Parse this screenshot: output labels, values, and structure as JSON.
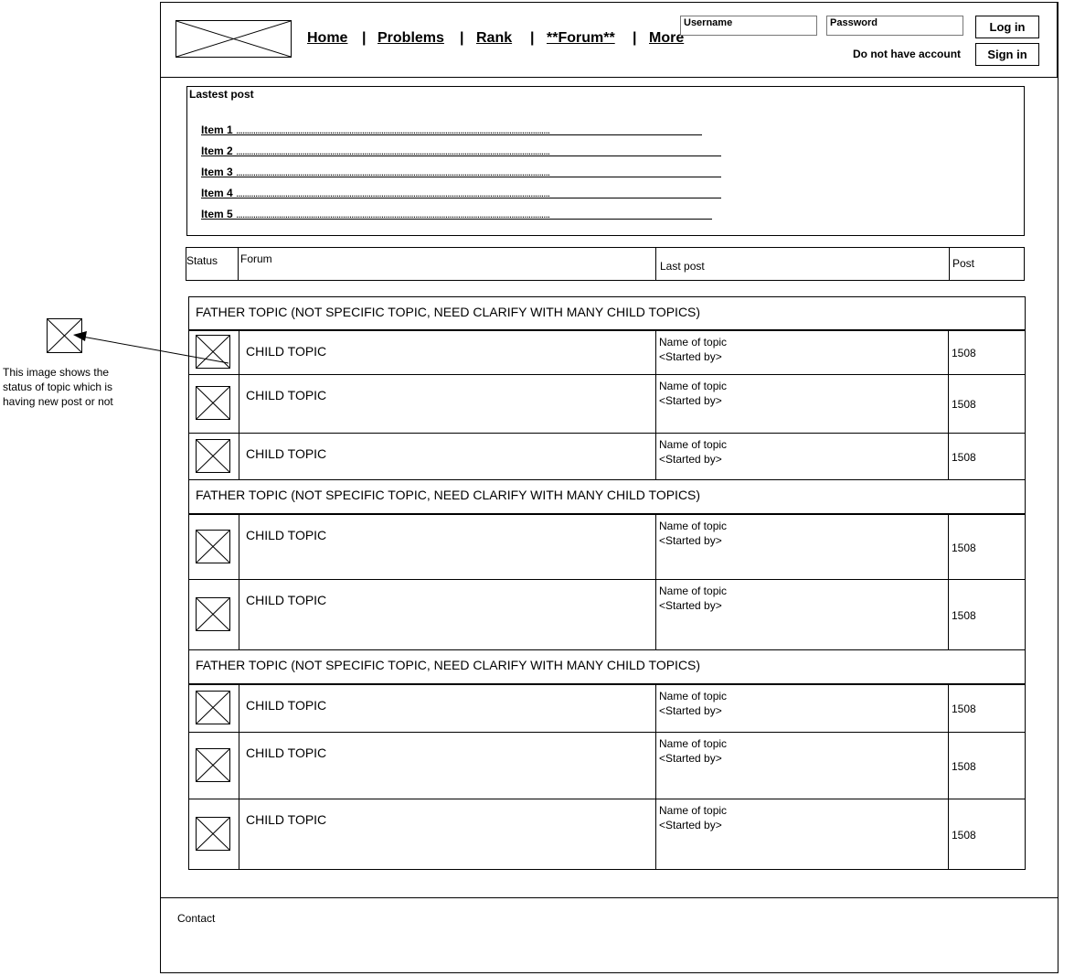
{
  "header": {
    "nav": [
      {
        "label": "Home",
        "sep": "|"
      },
      {
        "label": " Problems",
        "sep": "|"
      },
      {
        "label": " Rank ",
        "sep": "|"
      },
      {
        "label": " **Forum** ",
        "sep": "|"
      },
      {
        "label": " More",
        "sep": ""
      }
    ],
    "username_placeholder": "Username",
    "password_placeholder": "Password",
    "login_label": "Log in",
    "no_account_text": "Do not have account",
    "signin_label": "Sign in"
  },
  "latest": {
    "title": "Lastest post",
    "items": [
      {
        "label": "Item 1 ",
        "dots": "..................................................................................................................................................."
      },
      {
        "label": "Item 2 ",
        "dots": "..................................................................................................................................................."
      },
      {
        "label": "Item 3 ",
        "dots": "..................................................................................................................................................."
      },
      {
        "label": "Item 4 ",
        "dots": "..................................................................................................................................................."
      },
      {
        "label": "Item 5 ",
        "dots": "..................................................................................................................................................."
      }
    ]
  },
  "table_header": {
    "status": "Status",
    "forum": "Forum",
    "last_post": "Last post",
    "post": "Post"
  },
  "groups": [
    {
      "father": "FATHER TOPIC (NOT SPECIFIC TOPIC, NEED CLARIFY WITH MANY CHILD TOPICS)",
      "children": [
        {
          "name": "CHILD TOPIC",
          "last_name": "Name of topic",
          "last_by": "<Started by>",
          "count": "1508"
        },
        {
          "name": "CHILD TOPIC",
          "last_name": "Name of topic",
          "last_by": "<Started by>",
          "count": "1508"
        },
        {
          "name": "CHILD TOPIC",
          "last_name": "Name of topic",
          "last_by": "<Started by>",
          "count": "1508"
        }
      ]
    },
    {
      "father": "FATHER TOPIC (NOT SPECIFIC TOPIC, NEED CLARIFY WITH MANY CHILD TOPICS)",
      "children": [
        {
          "name": "CHILD TOPIC",
          "last_name": "Name of topic",
          "last_by": "<Started by>",
          "count": "1508"
        },
        {
          "name": "CHILD TOPIC",
          "last_name": "Name of topic",
          "last_by": "<Started by>",
          "count": "1508"
        }
      ]
    },
    {
      "father": "FATHER TOPIC (NOT SPECIFIC TOPIC, NEED CLARIFY WITH MANY CHILD TOPICS)",
      "children": [
        {
          "name": "CHILD TOPIC",
          "last_name": "Name of topic",
          "last_by": "<Started by>",
          "count": "1508"
        },
        {
          "name": "CHILD TOPIC",
          "last_name": "Name of topic",
          "last_by": "<Started by>",
          "count": "1508"
        },
        {
          "name": "CHILD TOPIC",
          "last_name": "Name of topic",
          "last_by": "<Started by>",
          "count": "1508"
        }
      ]
    }
  ],
  "annotation": {
    "line1": "This image shows the",
    "line2": "status of topic which is",
    "line3": "having new post or not"
  },
  "footer": {
    "contact": "Contact"
  },
  "icons": {
    "logo": "image-placeholder-icon",
    "status": "image-placeholder-icon"
  }
}
